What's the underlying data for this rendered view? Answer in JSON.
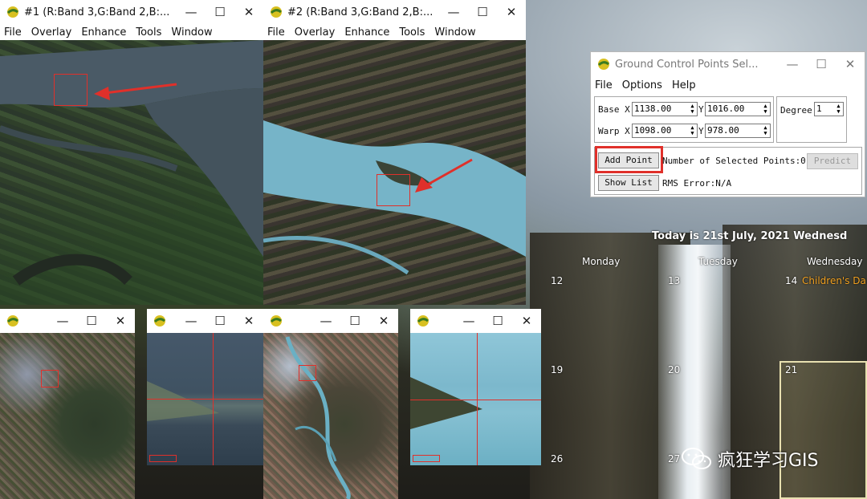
{
  "win1": {
    "title": "#1 (R:Band 3,G:Band 2,B:...",
    "menu": [
      "File",
      "Overlay",
      "Enhance",
      "Tools",
      "Window"
    ]
  },
  "win2": {
    "title": "#2 (R:Band 3,G:Band 2,B:...",
    "menu": [
      "File",
      "Overlay",
      "Enhance",
      "Tools",
      "Window"
    ]
  },
  "gcp": {
    "title": "Ground Control Points Sel...",
    "menu": [
      "File",
      "Options",
      "Help"
    ],
    "base_label": "Base X",
    "warp_label": "Warp X",
    "y_label": "Y",
    "base_x": "1138.00",
    "base_y": "1016.00",
    "warp_x": "1098.00",
    "warp_y": "978.00",
    "degree_label": "Degree",
    "degree": "1",
    "add_point": "Add Point",
    "selected_points": "Number of Selected Points:0",
    "predict": "Predict",
    "show_list": "Show List",
    "rms": "RMS Error:N/A"
  },
  "calendar": {
    "today": "Today is 21st July, 2021 Wednesd",
    "days": [
      "Monday",
      "Tuesday",
      "Wednesday"
    ],
    "dates": [
      "12",
      "13",
      "14",
      "19",
      "20",
      "21",
      "26",
      "27"
    ],
    "holiday": "Children's Da"
  },
  "watermark": {
    "text": "疯狂学习GIS"
  },
  "colors": {
    "accent_red": "#e0302a",
    "holiday_orange": "#f0a020"
  }
}
